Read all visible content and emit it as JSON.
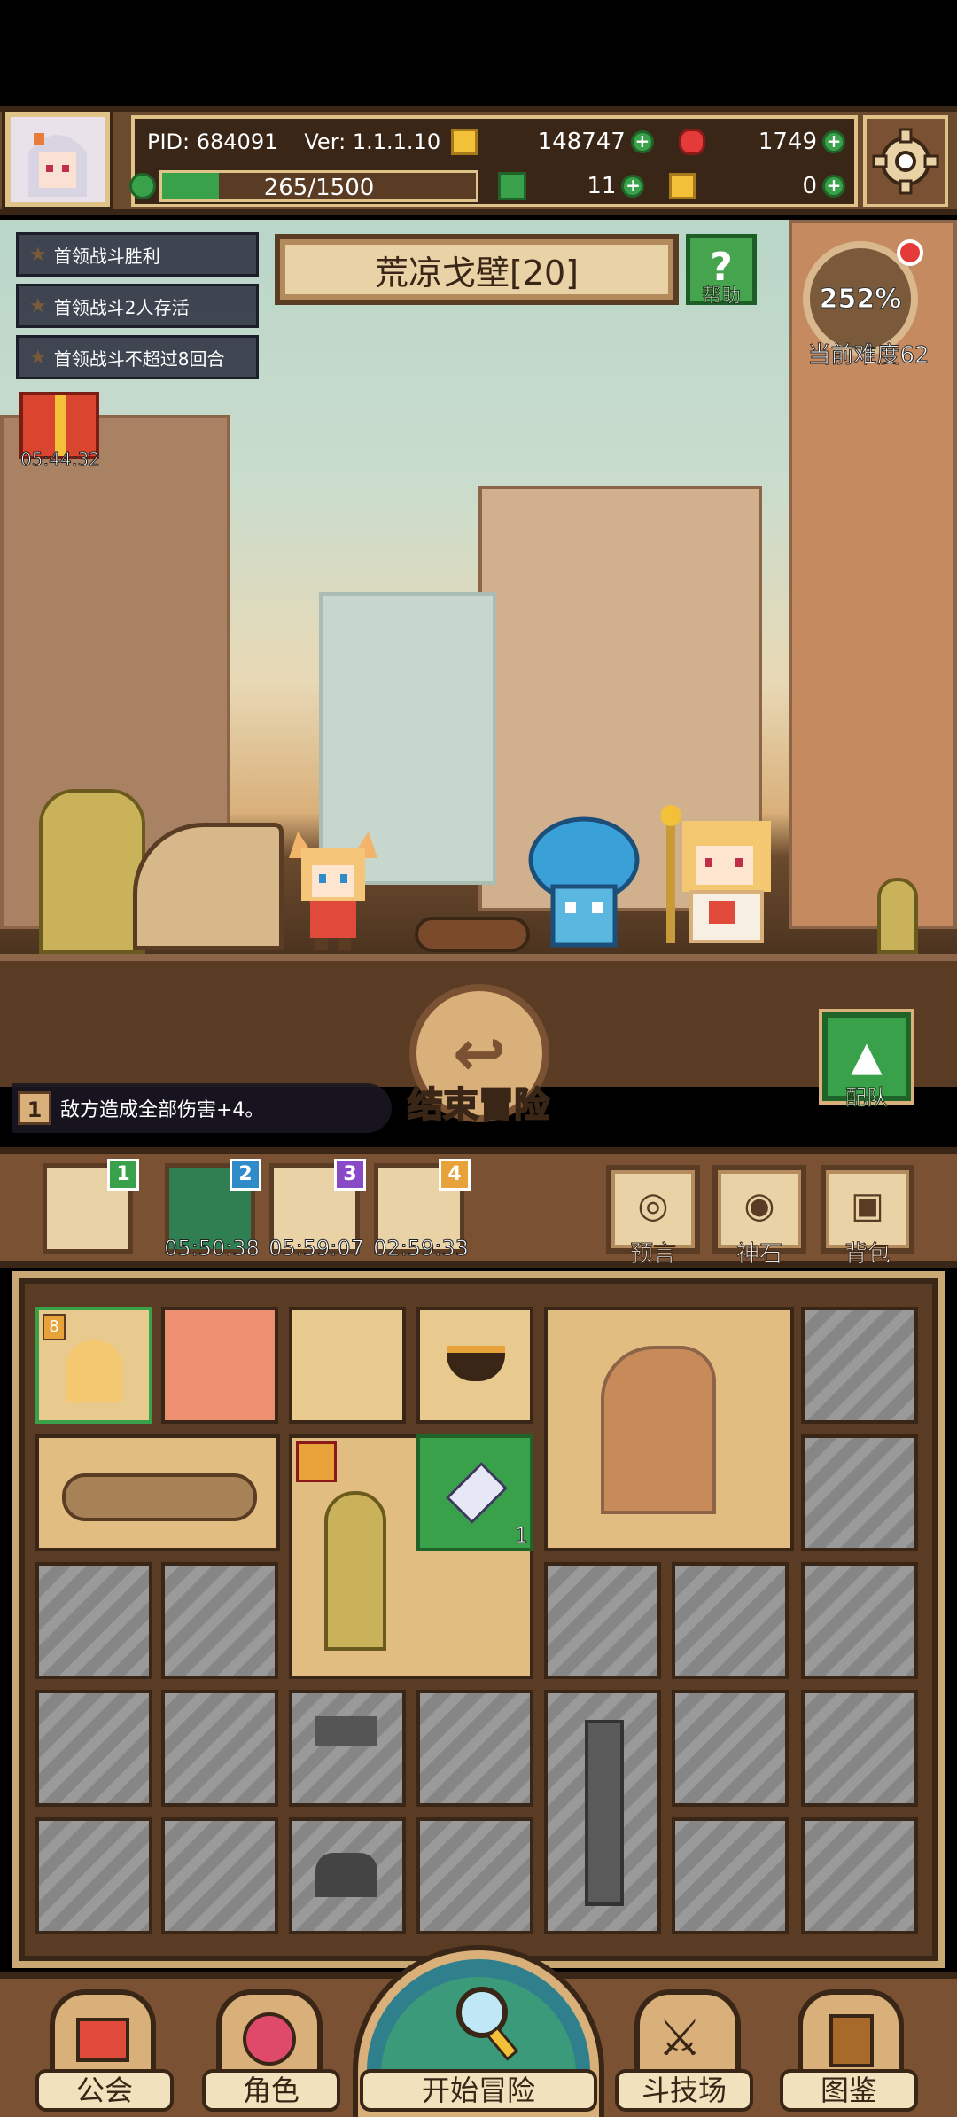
{
  "hud": {
    "pid": "PID: 684091",
    "version": "Ver: 1.1.1.10",
    "gold": "148747",
    "gems": "1749",
    "stamina": "265/1500",
    "clover": "11",
    "keys": "0",
    "plus": "+"
  },
  "quests": [
    "首领战斗胜利",
    "首领战斗2人存活",
    "首领战斗不超过8回合"
  ],
  "stage_title": "荒凉戈壁[20]",
  "help_label": "帮助",
  "difficulty": {
    "percent": "252%",
    "label": "当前难度62"
  },
  "gift_timer": "05:44:32",
  "end_adventure": "结束冒险",
  "team_label": "配队",
  "effect": {
    "num": "1",
    "text": "敌方造成全部伤害+4。"
  },
  "stages": [
    {
      "num": "1",
      "timer": ""
    },
    {
      "num": "2",
      "timer": "05:50:38"
    },
    {
      "num": "3",
      "timer": "05:59:07"
    },
    {
      "num": "4",
      "timer": "02:59:33"
    }
  ],
  "side_buttons": [
    "预言",
    "神石",
    "背包"
  ],
  "inventory": {
    "gem_count": "1",
    "hero_level": "8"
  },
  "nav": [
    "公会",
    "角色",
    "开始冒险",
    "斗技场",
    "图鉴"
  ],
  "colors": {
    "brown_dark": "#3a2616",
    "brown": "#7a5233",
    "sand": "#e8c98e",
    "green": "#3aa14b",
    "red": "#e43a3a"
  }
}
